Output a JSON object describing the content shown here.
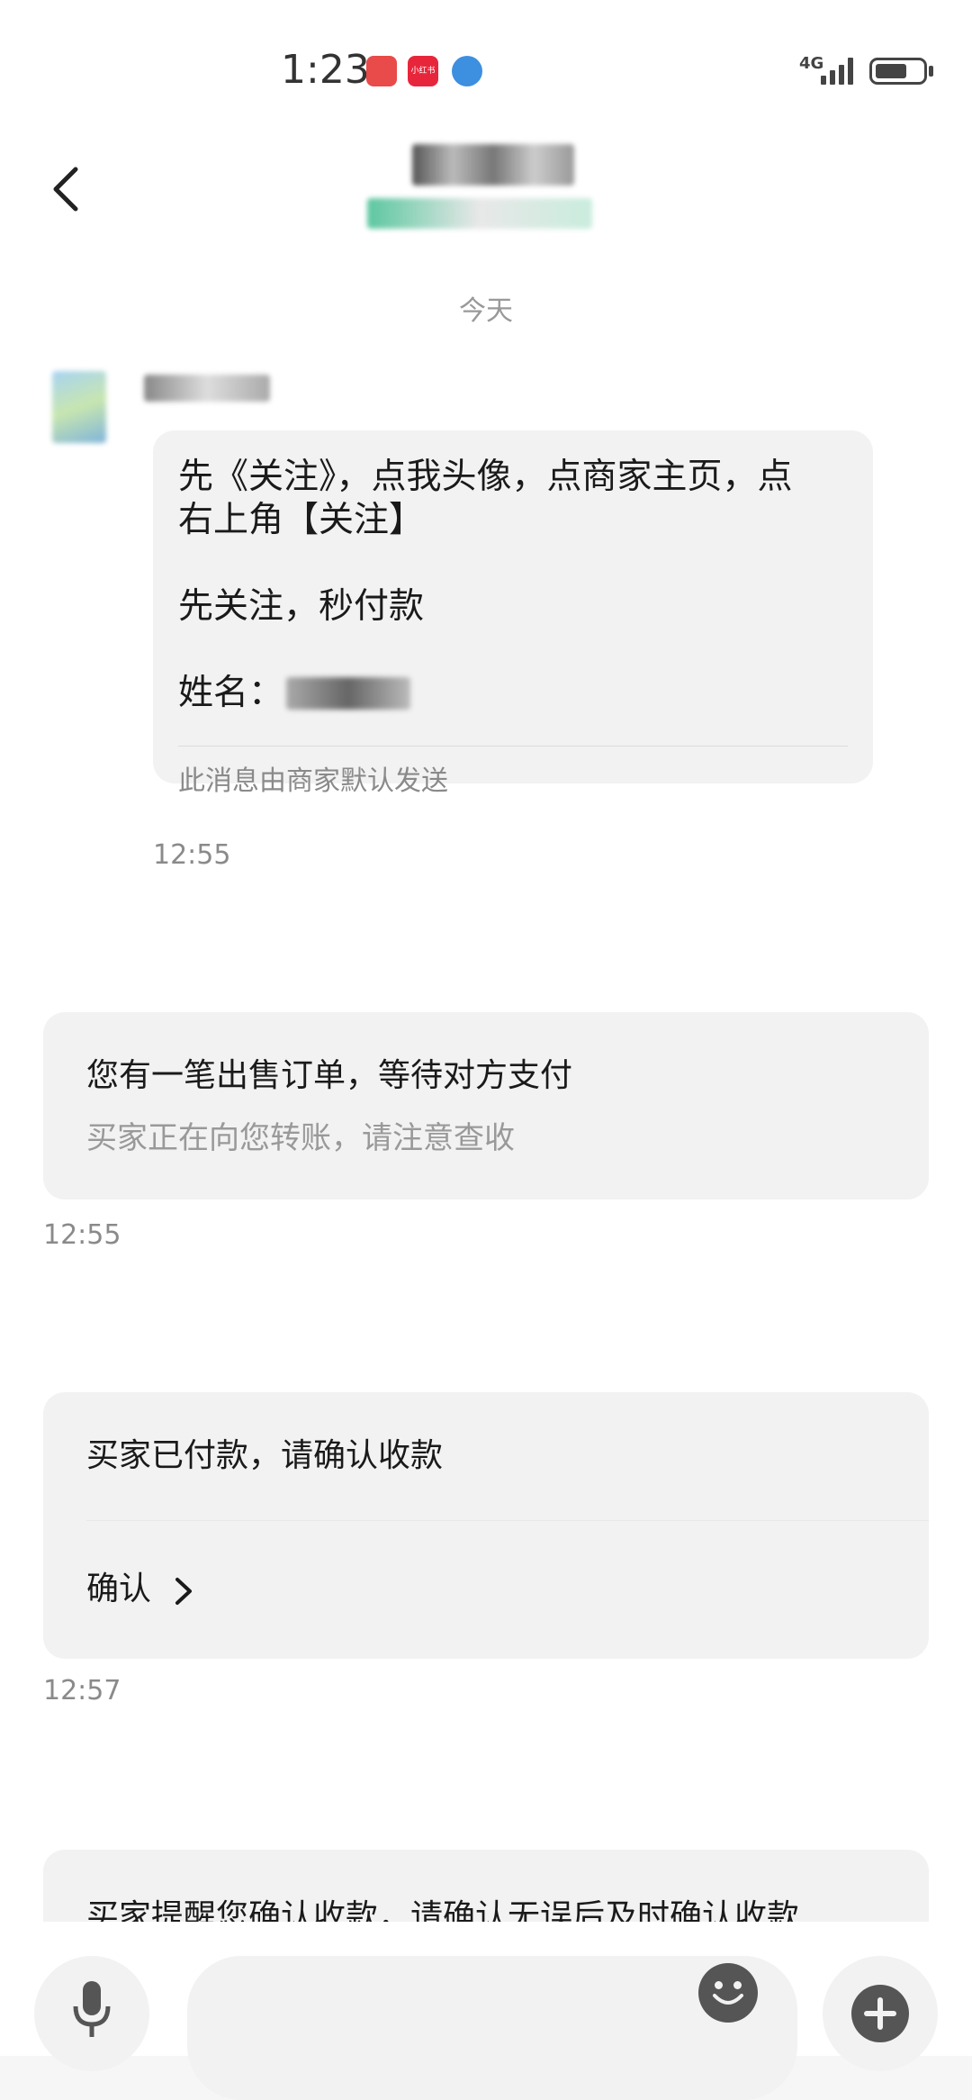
{
  "status_bar": {
    "time": "1:23",
    "network": "4G",
    "icons": [
      "app-icon-red",
      "app-icon-xiaohongshu",
      "app-icon-browser",
      "signal-icon",
      "battery-icon"
    ],
    "xiaohongshu_label": "小红书"
  },
  "header": {
    "back_icon": "chevron-left-icon"
  },
  "chat": {
    "date_divider": "今天",
    "messages": [
      {
        "lines": [
          "先《关注》，点我头像，点商家主页，点",
          "右上角【关注】",
          "先关注，秒付款",
          "姓名："
        ],
        "note": "此消息由商家默认发送",
        "time": "12:55"
      },
      {
        "title": "您有一笔出售订单，等待对方支付",
        "subtitle": "买家正在向您转账，请注意查收",
        "time": "12:55"
      },
      {
        "title": "买家已付款，请确认收款",
        "action": "确认",
        "time": "12:57"
      },
      {
        "title": "买家提醒您确认收款，请确认无误后及时确认收款"
      }
    ]
  },
  "input_bar": {
    "icons": [
      "microphone-icon",
      "emoji-icon",
      "plus-icon"
    ]
  },
  "colors": {
    "bubble": "#f2f2f2",
    "secondary_text": "#999999",
    "background": "#ffffff"
  }
}
